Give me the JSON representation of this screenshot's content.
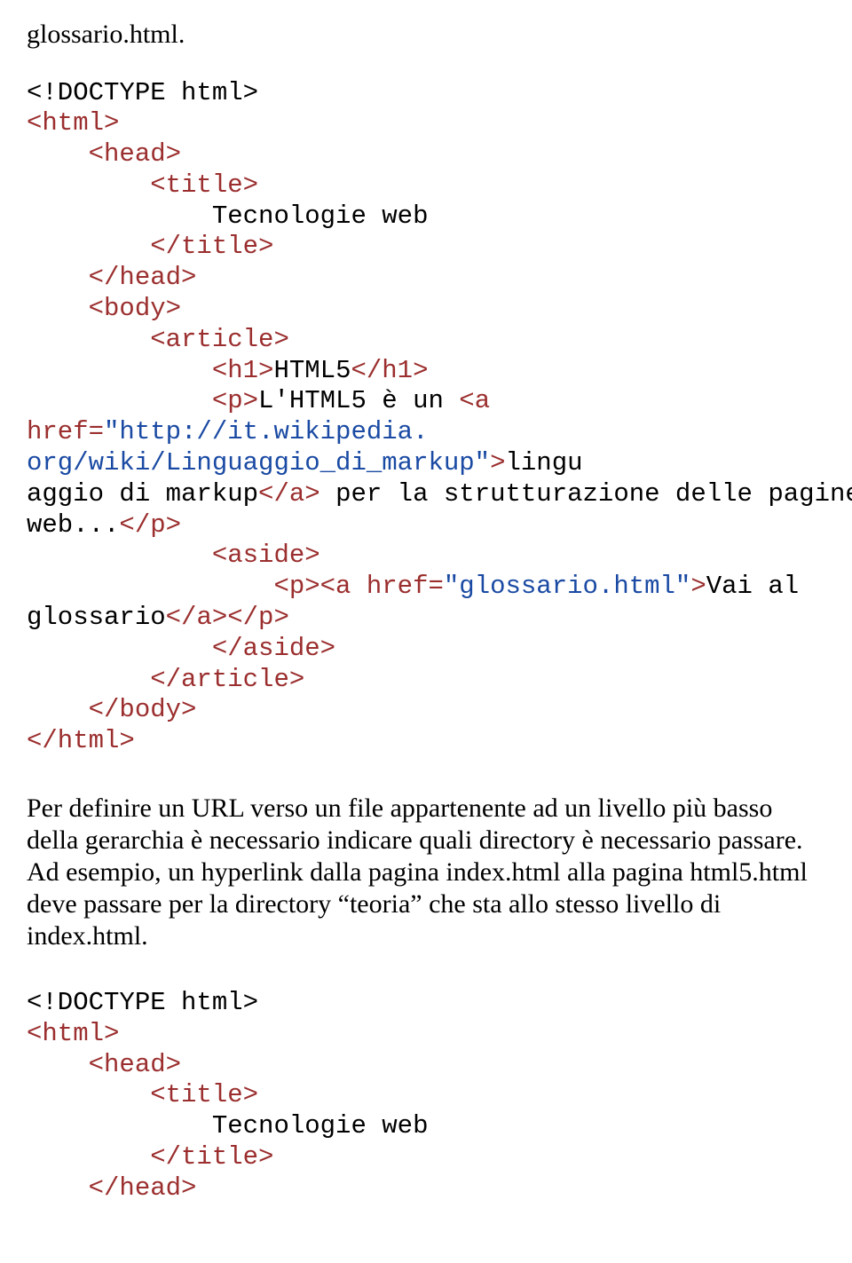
{
  "intro": "glossario.html.",
  "code1": {
    "l01a": "<!DOCTYPE html>",
    "l02a": "<html>",
    "l03a": "    <head>",
    "l04a": "        <title>",
    "l05a": "            Tecnologie web",
    "l06a": "        </title>",
    "l07a": "    </head>",
    "l08a": "    <body>",
    "l09a": "        <article>",
    "l10a": "            <h1>",
    "l10b": "HTML5",
    "l10c": "</h1>",
    "l11a": "            <p>",
    "l11b": "L'HTML5 è un ",
    "l11c": "<a ",
    "l12a": "href=",
    "l12b": "\"http://it.wikipedia.",
    "l13a": "org/wiki/Linguaggio_di_markup\"",
    "l13b": ">",
    "l13c": "lingu",
    "l14a": "aggio di markup",
    "l14b": "</a>",
    "l14c": " per la strutturazione delle pagine",
    "l15a": "web...",
    "l15b": "</p>",
    "l16a": "            <aside>",
    "l17a": "                <p><a href=",
    "l17b": "\"glossario.html\"",
    "l17c": ">",
    "l17d": "Vai al",
    "l18a": "glossario",
    "l18b": "</a></p>",
    "l19a": "            </aside>",
    "l20a": "        </article>",
    "l21a": "    </body>",
    "l22a": "</html>"
  },
  "para": "Per definire un URL verso un file appartenente ad un livello più basso della gerarchia è necessario indicare quali directory è necessario passare. Ad esempio, un hyperlink dalla pagina index.html alla pagina html5.html deve passare per la directory “teoria” che sta allo stesso livello di index.html.",
  "code2": {
    "l01a": "<!DOCTYPE html>",
    "l02a": "<html>",
    "l03a": "    <head>",
    "l04a": "        <title>",
    "l05a": "            Tecnologie web",
    "l06a": "        </title>",
    "l07a": "    </head>"
  }
}
